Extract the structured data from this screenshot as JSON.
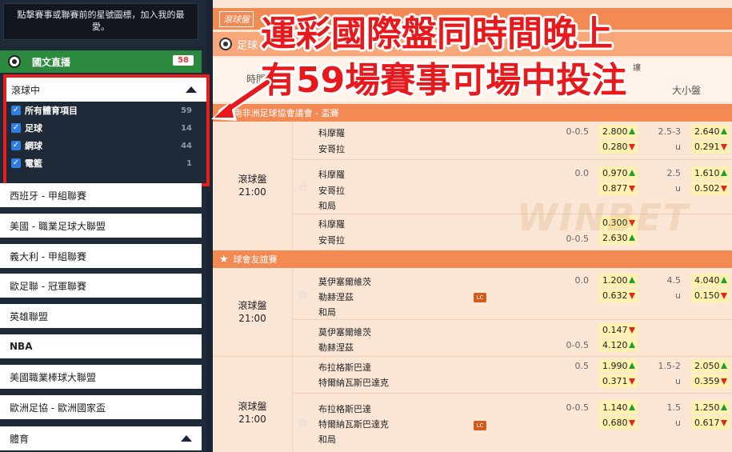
{
  "sidebar": {
    "favorites_hint": "點擊賽事或聯賽前的星號圖標，加入我的最愛。",
    "live": {
      "label": "國文直播",
      "count": "58"
    },
    "inplay": {
      "title": "滾球中",
      "items": [
        {
          "label": "所有體育項目",
          "count": "59"
        },
        {
          "label": "足球",
          "count": "14"
        },
        {
          "label": "網球",
          "count": "44"
        },
        {
          "label": "電籃",
          "count": "1"
        }
      ]
    },
    "leagues": [
      "西班牙 - 甲組聯賽",
      "美國 - 職業足球大聯盟",
      "義大利 - 甲組聯賽",
      "歐足聯 - 冠軍聯賽",
      "英雄聯盟",
      "NBA",
      "美國職業棒球大聯盟",
      "歐洲足協 - 歐洲國家盃",
      "體育"
    ]
  },
  "main": {
    "tag": "滾球盤",
    "sport": "足球",
    "col_time": "時間",
    "col_ou": "大小盤",
    "col_hidden": "讓",
    "competitions": [
      "南非洲足球協會議會 - 盃賽",
      "球會友誼賽"
    ],
    "match_time_label": "滾球盤",
    "kickoff": "21:00",
    "teams": {
      "a1": "科摩羅",
      "a2": "安哥拉",
      "b1": "莫伊塞爾維茨",
      "b2": "勒赫涅茲",
      "c1": "布拉格斯巴達",
      "c2": "特爾納瓦斯巴達克",
      "draw": "和局"
    },
    "lc_icon": "LC",
    "rows": {
      "r1": {
        "hcap": "0-0.5",
        "h1": "2.800",
        "h2": "0.280",
        "ou": "2.5-3",
        "ou_u": "u",
        "o1": "2.640",
        "o2": "0.291"
      },
      "r2": {
        "hcap": "0.0",
        "h1": "0.970",
        "h2": "0.877",
        "ou": "2.5",
        "ou_u": "u",
        "o1": "1.610",
        "o2": "0.502"
      },
      "r3": {
        "hcap": "0-0.5",
        "h1": "0.300",
        "h2": "2.630"
      },
      "r4": {
        "hcap": "0.0",
        "h1": "1.200",
        "h2": "0.632",
        "ou": "4.5",
        "ou_u": "u",
        "o1": "4.040",
        "o2": "0.150"
      },
      "r5": {
        "hcap": "0-0.5",
        "h1": "0.147",
        "h2": "4.120"
      },
      "r6": {
        "hcap": "0.5",
        "h1": "1.990",
        "h2": "0.371",
        "ou": "1.5-2",
        "ou_u": "u",
        "o1": "2.050",
        "o2": "0.359"
      },
      "r7": {
        "hcap": "0-0.5",
        "h1": "1.140",
        "h2": "0.680",
        "ou": "1.5",
        "ou_u": "u",
        "o1": "1.250",
        "o2": "0.617"
      }
    }
  },
  "overlay": {
    "line1": "運彩國際盤同時間晚上",
    "line2": "有59場賽事可場中投注"
  },
  "watermark": "WINBET"
}
